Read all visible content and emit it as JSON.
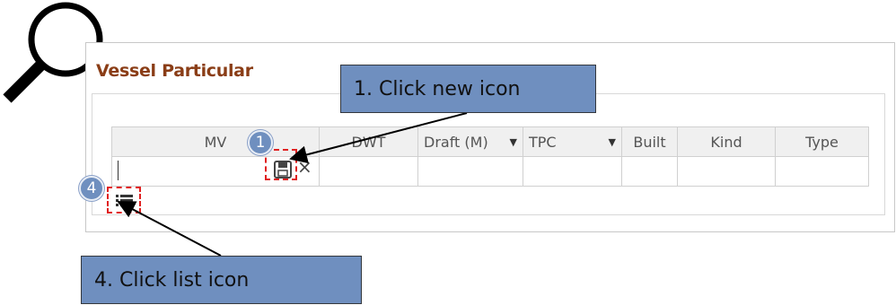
{
  "section": {
    "title": "Vessel Particular"
  },
  "grid": {
    "columns": [
      {
        "label": "MV",
        "dropdown": false
      },
      {
        "label": "DWT",
        "dropdown": false
      },
      {
        "label": "Draft (M)",
        "dropdown": true
      },
      {
        "label": "TPC",
        "dropdown": true
      },
      {
        "label": "Built",
        "dropdown": false
      },
      {
        "label": "Kind",
        "dropdown": false
      },
      {
        "label": "Type",
        "dropdown": false
      }
    ]
  },
  "annotations": {
    "badge1": "1",
    "badge4": "4",
    "callout1": "1. Click new icon",
    "callout4": "4.  Click list icon",
    "highlight_color": "#e02020",
    "callout_color": "#6f8fbf"
  },
  "icons": {
    "magnifier": "magnifier-icon",
    "save": "save-icon",
    "close": "close-icon",
    "list": "list-icon"
  }
}
